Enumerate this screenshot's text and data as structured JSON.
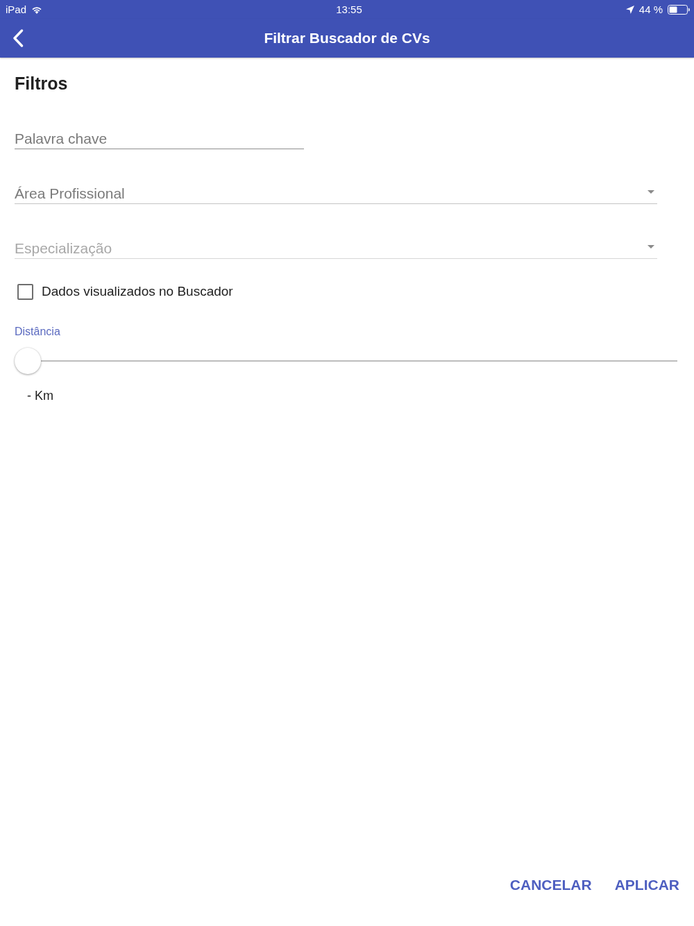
{
  "status_bar": {
    "device": "iPad",
    "time": "13:55",
    "battery": "44 %"
  },
  "nav_bar": {
    "title": "Filtrar Buscador de CVs"
  },
  "section_title": "Filtros",
  "fields": [
    {
      "kind": "text",
      "placeholder": "Palavra chave",
      "disabled": false
    },
    {
      "kind": "select",
      "placeholder": "Área Profissional",
      "disabled": false
    },
    {
      "kind": "select",
      "placeholder": "Especialização",
      "disabled": true
    }
  ],
  "checkbox": {
    "label": "Dados visualizados no Buscador",
    "checked": false
  },
  "distance": {
    "label": "Distância",
    "level": 0,
    "reading": "- Km"
  },
  "buttons": [
    "CANCELAR",
    "APLICAR"
  ]
}
